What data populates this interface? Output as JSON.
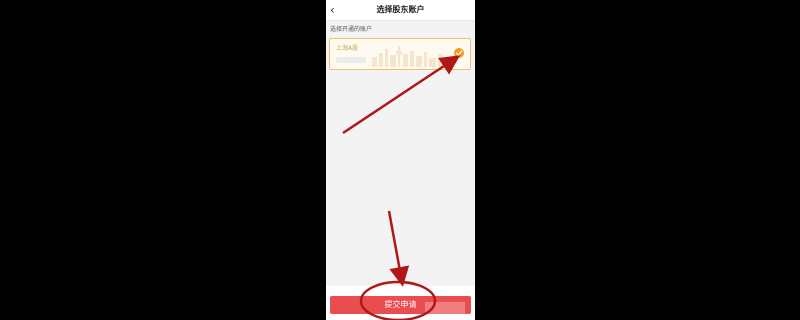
{
  "header": {
    "title": "选择股东账户",
    "back_icon": "chevron-left-icon"
  },
  "section": {
    "label": "选择开通的账户"
  },
  "account": {
    "name": "上海A股",
    "selected": true,
    "check_color": "#f29a1f",
    "border_color": "#f0c070"
  },
  "footer": {
    "submit_label": "提交申请",
    "button_color": "#ea4d4f"
  },
  "annotations": {
    "color": "#b01818",
    "arrow_count": 2,
    "circle_target": "submit-button"
  }
}
